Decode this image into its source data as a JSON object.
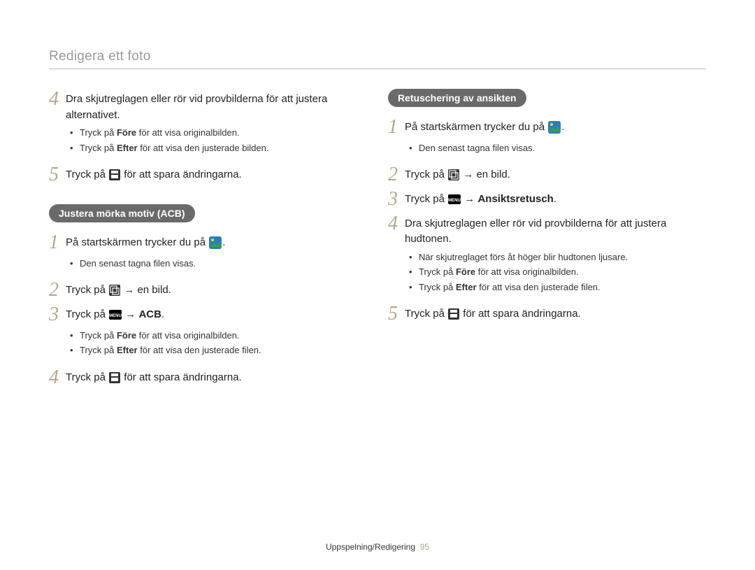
{
  "header": "Redigera ett foto",
  "footer": {
    "section": "Uppspelning/Redigering",
    "page": "95"
  },
  "left": {
    "step4_text": "Dra skjutreglagen eller rör vid provbilderna för att justera alternativet.",
    "step4_bullets": [
      {
        "pre": "Tryck på ",
        "bold": "Före",
        "post": " för att visa originalbilden."
      },
      {
        "pre": "Tryck på ",
        "bold": "Efter",
        "post": " för att visa den justerade bilden."
      }
    ],
    "step5_pre": "Tryck på ",
    "step5_post": " för att spara ändringarna.",
    "pill": "Justera mörka motiv (ACB)",
    "acb": {
      "s1_pre": "På startskärmen trycker du på ",
      "s1_post": ".",
      "s1_bullet": "Den senast tagna filen visas.",
      "s2_pre": "Tryck på ",
      "s2_mid": " → en bild.",
      "s3_pre": "Tryck på ",
      "s3_arrow": " → ",
      "s3_bold": "ACB",
      "s3_post": ".",
      "s3_bullets": [
        {
          "pre": "Tryck på ",
          "bold": "Före",
          "post": " för att visa originalbilden."
        },
        {
          "pre": "Tryck på ",
          "bold": "Efter",
          "post": " för att visa den justerade filen."
        }
      ],
      "s4_pre": "Tryck på ",
      "s4_post": " för att spara ändringarna."
    }
  },
  "right": {
    "pill": "Retuschering av ansikten",
    "s1_pre": "På startskärmen trycker du på ",
    "s1_post": ".",
    "s1_bullet": "Den senast tagna filen visas.",
    "s2_pre": "Tryck på ",
    "s2_mid": " → en bild.",
    "s3_pre": "Tryck på ",
    "s3_arrow": " → ",
    "s3_bold": "Ansiktsretusch",
    "s3_post": ".",
    "s4_text": "Dra skjutreglagen eller rör vid provbilderna för att justera hudtonen.",
    "s4_bullets": [
      "När skjutreglaget förs åt höger blir hudtonen ljusare.",
      {
        "pre": "Tryck på ",
        "bold": "Före",
        "post": " för att visa originalbilden."
      },
      {
        "pre": "Tryck på ",
        "bold": "Efter",
        "post": " för att visa den justerade filen."
      }
    ],
    "s5_pre": "Tryck på ",
    "s5_post": " för att spara ändringarna."
  },
  "nums": {
    "n1": "1",
    "n2": "2",
    "n3": "3",
    "n4": "4",
    "n5": "5"
  }
}
